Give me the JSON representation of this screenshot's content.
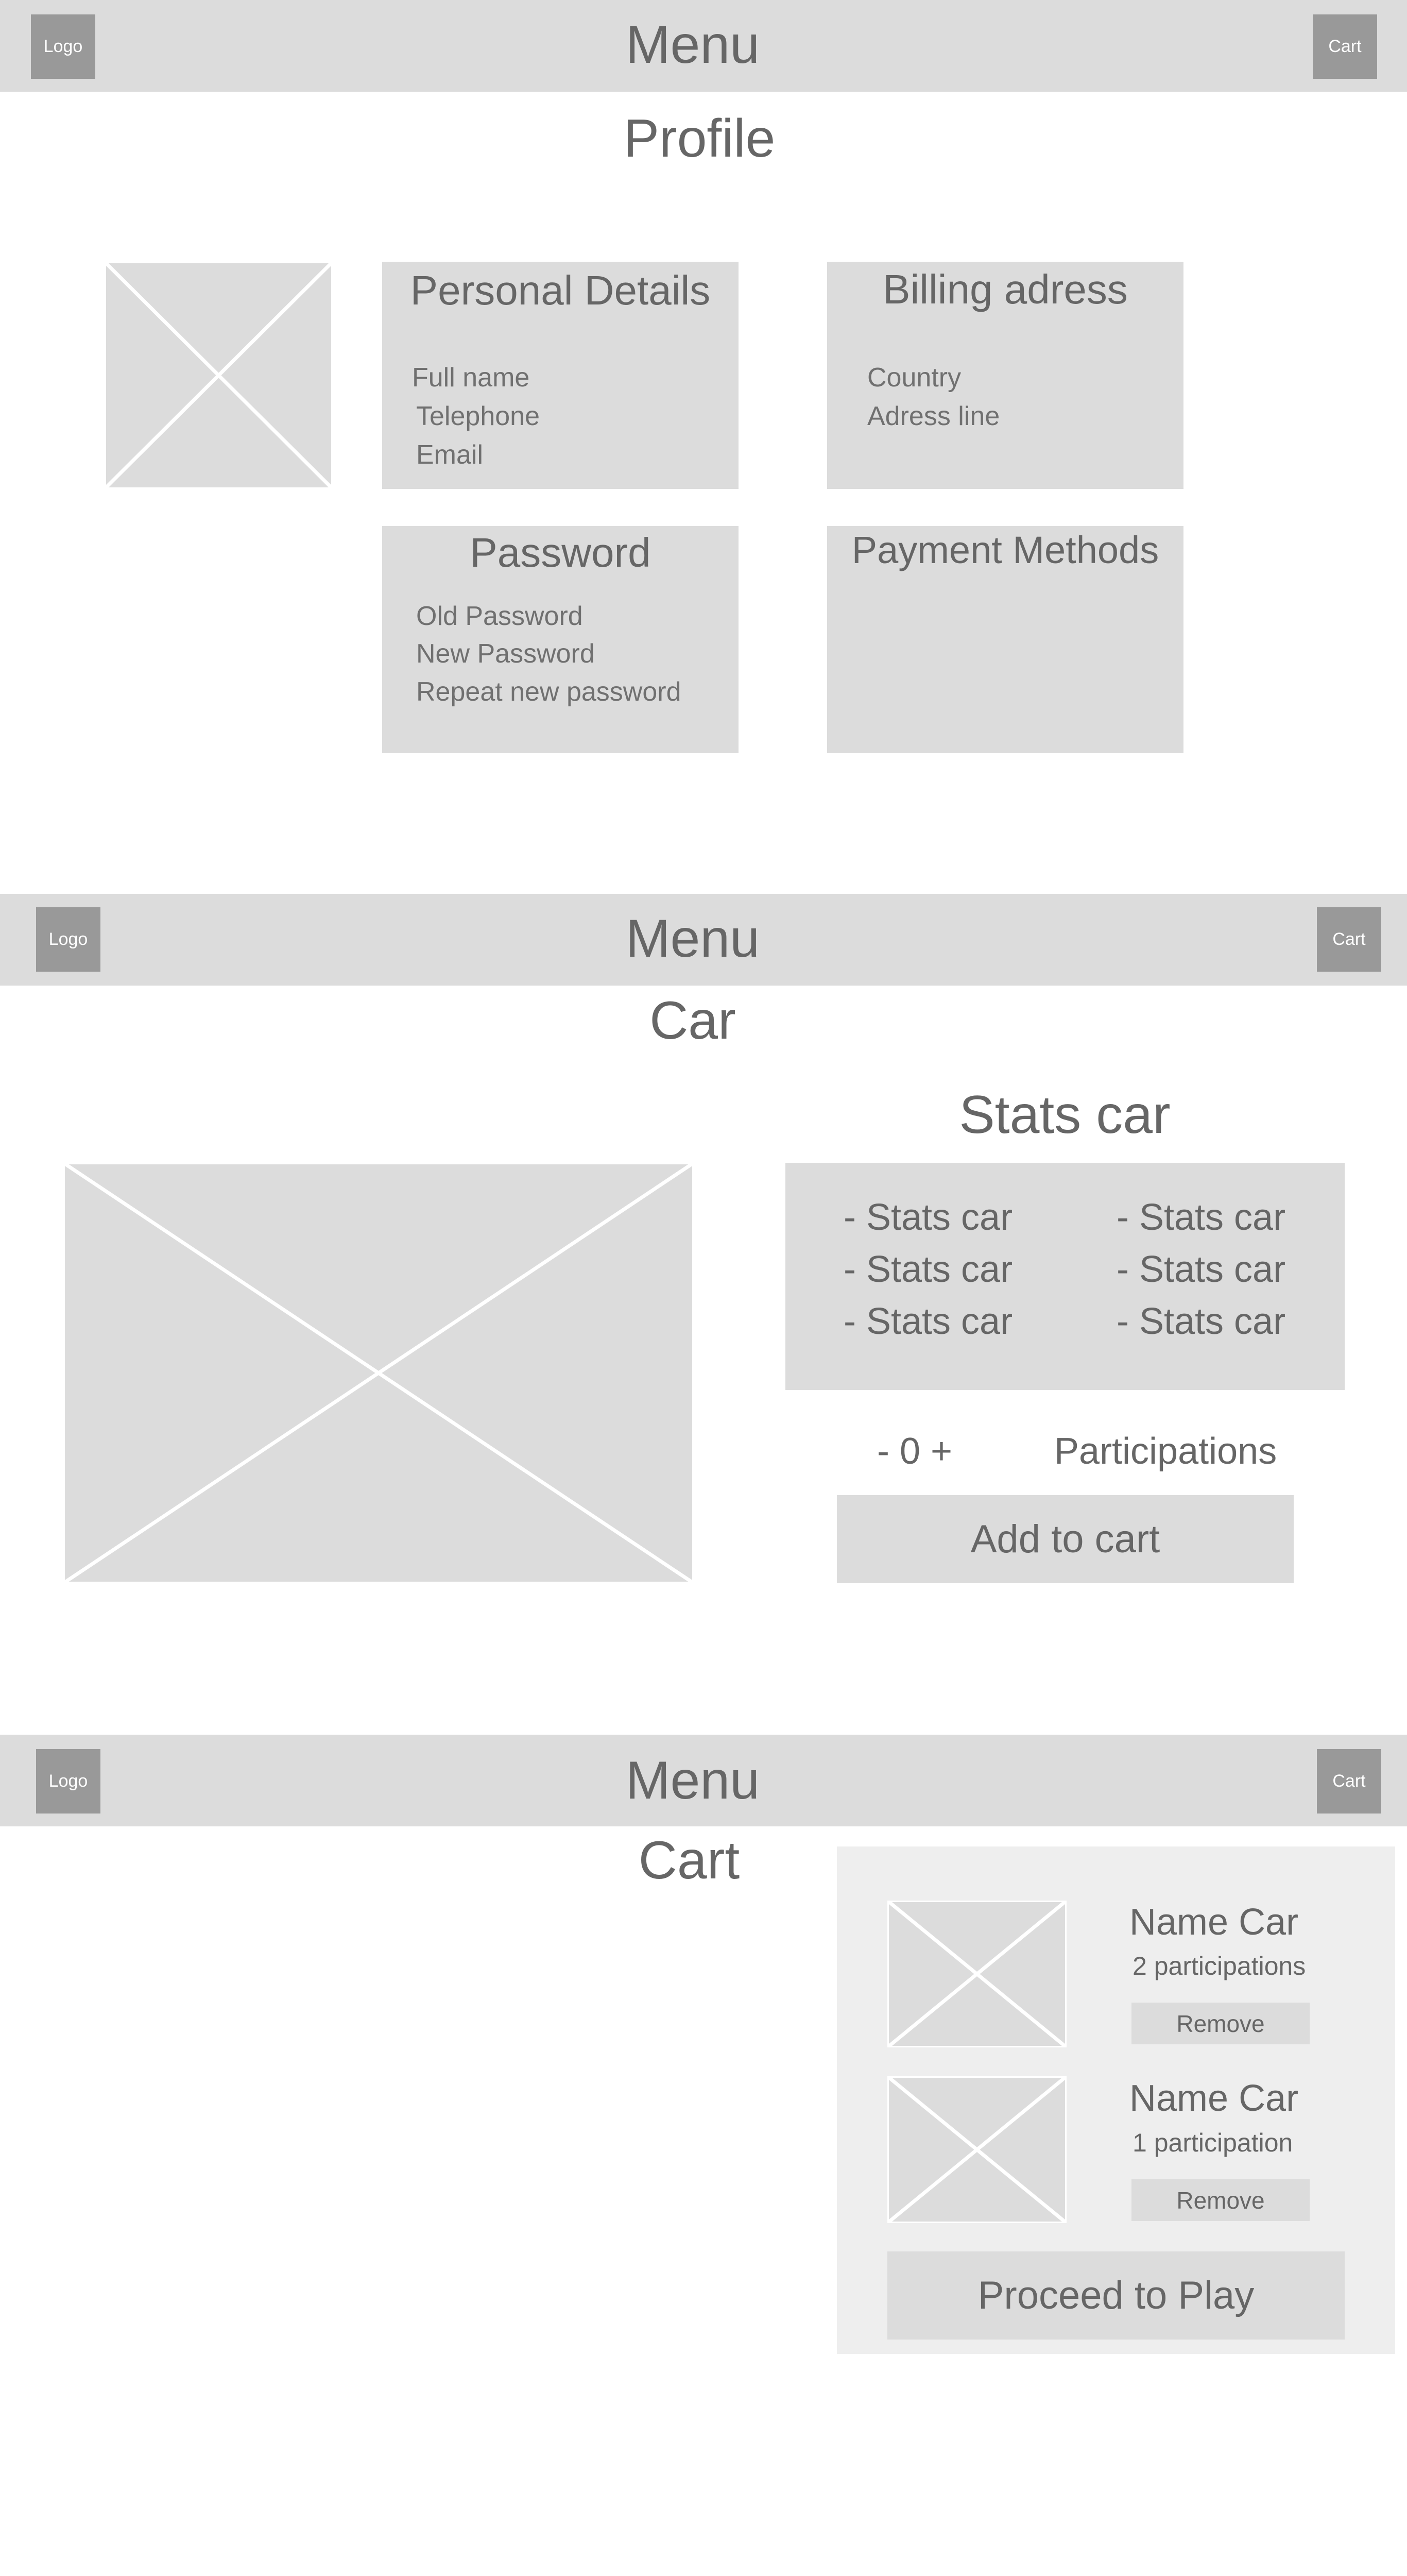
{
  "header": {
    "logo_label": "Logo",
    "menu_label": "Menu",
    "cart_label": "Cart"
  },
  "profile": {
    "title": "Profile",
    "personal": {
      "heading": "Personal Details",
      "fields": [
        "Full name",
        "Telephone",
        "Email"
      ]
    },
    "billing": {
      "heading": "Billing adress",
      "fields": [
        "Country",
        "Adress line"
      ]
    },
    "password": {
      "heading": "Password",
      "fields": [
        "Old Password",
        "New Password",
        "Repeat new password"
      ]
    },
    "payment": {
      "heading": "Payment Methods"
    }
  },
  "car": {
    "title": "Car",
    "stats_heading": "Stats car",
    "stats": [
      "- Stats car",
      "- Stats car",
      "- Stats car",
      "- Stats car",
      "- Stats car",
      "- Stats car"
    ],
    "stepper": "- 0 +",
    "participations_label": "Participations",
    "add_to_cart": "Add to cart"
  },
  "cart": {
    "title": "Cart",
    "items": [
      {
        "name": "Name Car",
        "participations": "2 participations",
        "remove_label": "Remove"
      },
      {
        "name": "Name Car",
        "participations": "1 participation",
        "remove_label": "Remove"
      }
    ],
    "proceed_label": "Proceed to Play"
  },
  "colors": {
    "nav_bg": "#dcdcdc",
    "icon_box": "#999999",
    "panel_bg": "#dcdcdc",
    "cart_panel_bg": "#eeeeee",
    "text": "#666666"
  }
}
